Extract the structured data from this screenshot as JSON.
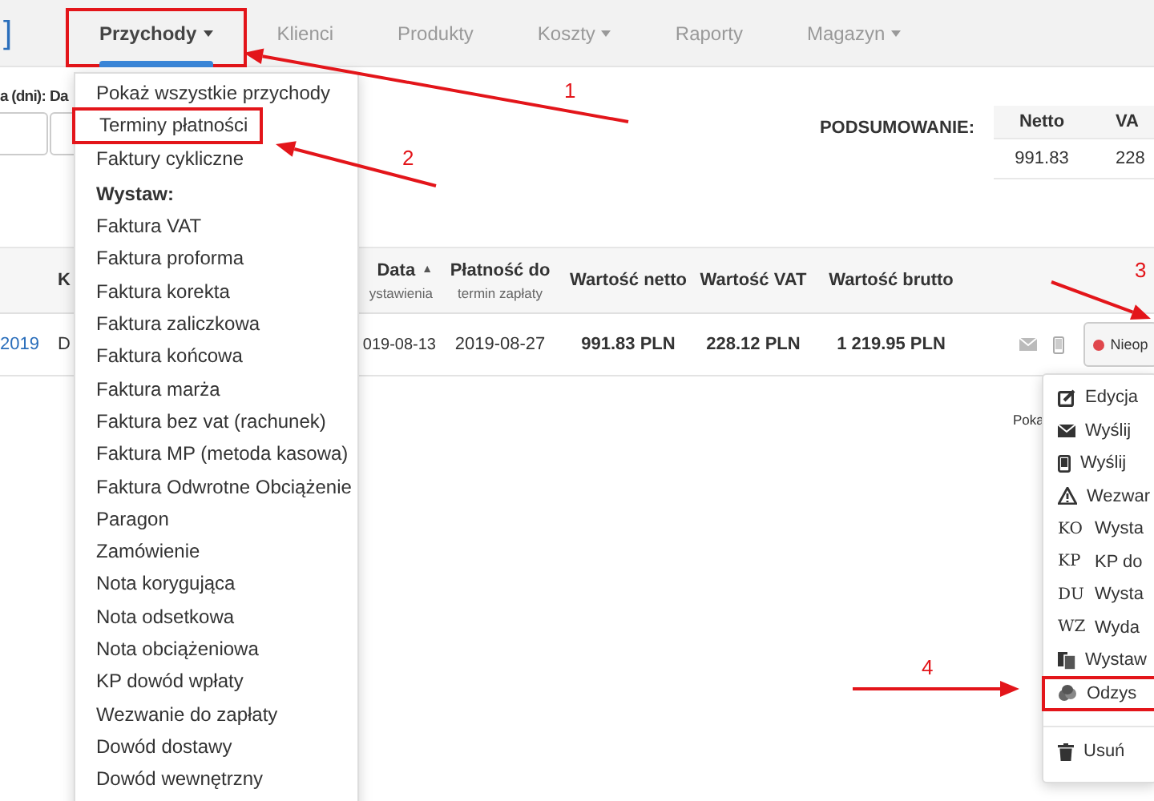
{
  "nav": {
    "logo": "]",
    "tabs": [
      {
        "label": "Przychody",
        "dropdown": true,
        "selected": true,
        "highlighted": true
      },
      {
        "label": "Klienci",
        "dropdown": false,
        "selected": false,
        "highlighted": false
      },
      {
        "label": "Produkty",
        "dropdown": false,
        "selected": false,
        "highlighted": false
      },
      {
        "label": "Koszty",
        "dropdown": true,
        "selected": false,
        "highlighted": false
      },
      {
        "label": "Raporty",
        "dropdown": false,
        "selected": false,
        "highlighted": false
      },
      {
        "label": "Magazyn",
        "dropdown": true,
        "selected": false,
        "highlighted": false
      }
    ]
  },
  "filters": [
    {
      "label": "a (dni):"
    },
    {
      "label": "Da"
    }
  ],
  "summary": {
    "title": "PODSUMOWANIE:",
    "columns": [
      "Netto",
      "VA"
    ],
    "rows": [
      [
        "991.83",
        "228"
      ]
    ]
  },
  "table": {
    "columns": [
      {},
      {
        "label": "K"
      },
      {
        "label": "Data",
        "sort_mark": "▲",
        "sublabel": "ystawienia"
      },
      {
        "label": "Płatność do",
        "sublabel": "termin zapłaty"
      },
      {
        "label": "Wartość netto"
      },
      {
        "label": "Wartość VAT"
      },
      {
        "label": "Wartość brutto"
      },
      {},
      {}
    ],
    "rows": [
      {
        "cells": [
          "2019",
          "D",
          "019-08-13",
          "2019-08-27",
          "991.83 PLN",
          "228.12 PLN",
          "1 219.95 PLN"
        ],
        "status": {
          "label": "Nieop",
          "color": "#e0474c"
        }
      }
    ]
  },
  "pagination_text": "Poka",
  "income_menu": {
    "items": [
      {
        "kind": "item",
        "label": "Pokaż wszystkie przychody",
        "highlighted": false
      },
      {
        "kind": "item",
        "label": "Terminy płatności",
        "highlighted": true
      },
      {
        "kind": "item",
        "label": "Faktury cykliczne",
        "highlighted": false
      },
      {
        "kind": "header",
        "label": "Wystaw:"
      },
      {
        "kind": "item",
        "label": "Faktura VAT",
        "highlighted": false
      },
      {
        "kind": "item",
        "label": "Faktura proforma",
        "highlighted": false
      },
      {
        "kind": "item",
        "label": "Faktura korekta",
        "highlighted": false
      },
      {
        "kind": "item",
        "label": "Faktura zaliczkowa",
        "highlighted": false
      },
      {
        "kind": "item",
        "label": "Faktura końcowa",
        "highlighted": false
      },
      {
        "kind": "item",
        "label": "Faktura marża",
        "highlighted": false
      },
      {
        "kind": "item",
        "label": "Faktura bez vat (rachunek)",
        "highlighted": false
      },
      {
        "kind": "item",
        "label": "Faktura MP (metoda kasowa)",
        "highlighted": false
      },
      {
        "kind": "item",
        "label": "Faktura Odwrotne Obciążenie",
        "highlighted": false
      },
      {
        "kind": "item",
        "label": "Paragon",
        "highlighted": false
      },
      {
        "kind": "item",
        "label": "Zamówienie",
        "highlighted": false
      },
      {
        "kind": "item",
        "label": "Nota korygująca",
        "highlighted": false
      },
      {
        "kind": "item",
        "label": "Nota odsetkowa",
        "highlighted": false
      },
      {
        "kind": "item",
        "label": "Nota obciążeniowa",
        "highlighted": false
      },
      {
        "kind": "item",
        "label": "KP dowód wpłaty",
        "highlighted": false
      },
      {
        "kind": "item",
        "label": "Wezwanie do zapłaty",
        "highlighted": false
      },
      {
        "kind": "item",
        "label": "Dowód dostawy",
        "highlighted": false
      },
      {
        "kind": "item",
        "label": "Dowód wewnętrzny",
        "highlighted": false
      }
    ]
  },
  "row_menu": {
    "items": [
      {
        "kind": "edit",
        "label": "Edycja",
        "highlighted": false
      },
      {
        "kind": "email",
        "label": "Wyślij",
        "highlighted": false
      },
      {
        "kind": "sms",
        "label": "Wyślij",
        "highlighted": false
      },
      {
        "kind": "warning",
        "label": "Wezwar",
        "highlighted": false
      },
      {
        "kind": "code",
        "code": "KO",
        "label": "Wysta",
        "highlighted": false
      },
      {
        "kind": "code",
        "code": "KP",
        "label": "KP do",
        "highlighted": false
      },
      {
        "kind": "code",
        "code": "DU",
        "label": "Wysta",
        "highlighted": false
      },
      {
        "kind": "code",
        "code": "WZ",
        "label": "Wyda",
        "highlighted": false
      },
      {
        "kind": "copy",
        "label": "Wystaw",
        "highlighted": false
      },
      {
        "kind": "recover",
        "label": "Odzys",
        "highlighted": true
      },
      {
        "kind": "delete",
        "label": "Usuń",
        "highlighted": false
      }
    ]
  },
  "annotations": [
    {
      "label": "1"
    },
    {
      "label": "2"
    },
    {
      "label": "3"
    },
    {
      "label": "4"
    }
  ]
}
